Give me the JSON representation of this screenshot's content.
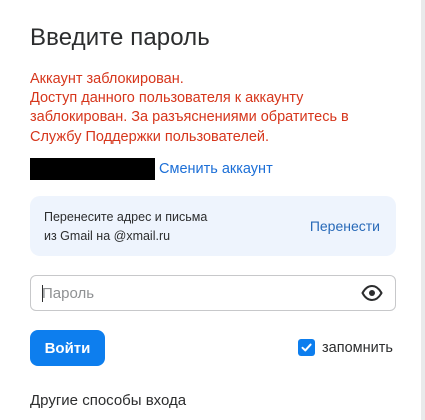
{
  "form": {
    "title": "Введите пароль",
    "error_lines": [
      "Аккаунт заблокирован.",
      "Доступ данного пользователя к аккаунту",
      "заблокирован. За разъяснениями обратитесь в",
      "Службу Поддержки пользователей."
    ],
    "switch_account_label": "Сменить аккаунт",
    "transfer": {
      "line1": "Перенесите адрес и письма",
      "line2": "из Gmail на @xmail.ru",
      "button_label": "Перенести"
    },
    "password": {
      "placeholder": "Пароль",
      "value": ""
    },
    "login_label": "Войти",
    "remember": {
      "label": "запомнить",
      "checked": true
    },
    "other_ways_label": "Другие способы входа"
  },
  "colors": {
    "error": "#d6361c",
    "link": "#1c6fd7",
    "primary": "#0d7eee",
    "card_bg": "#eef4fd"
  },
  "icons": {
    "password_toggle": "eye-icon",
    "checkbox": "checkmark-icon"
  }
}
